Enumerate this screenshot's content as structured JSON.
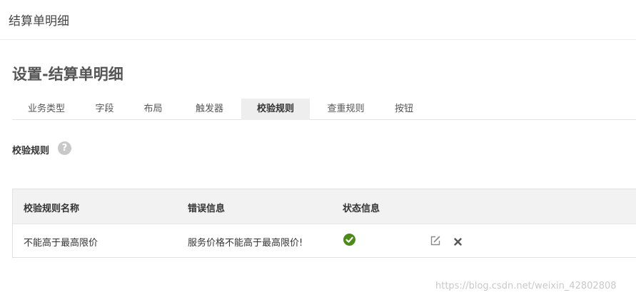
{
  "topbar": {
    "title": "结算单明细"
  },
  "page": {
    "title": "设置-结算单明细"
  },
  "tabs": [
    {
      "label": "业务类型"
    },
    {
      "label": "字段"
    },
    {
      "label": "布局"
    },
    {
      "label": "触发器"
    },
    {
      "label": "校验规则",
      "active": true
    },
    {
      "label": "查重规则"
    },
    {
      "label": "按钮"
    }
  ],
  "section": {
    "label": "校验规则",
    "help_icon": "question-icon",
    "help_glyph": "?"
  },
  "table": {
    "headers": [
      "校验规则名称",
      "错误信息",
      "状态信息"
    ],
    "rows": [
      {
        "name": "不能高于最高限价",
        "error": "服务价格不能高于最高限价!",
        "status_icon": "check-circle-icon",
        "actions": [
          "edit-icon",
          "delete-icon"
        ]
      }
    ]
  },
  "colors": {
    "status_ok": "#4c8a1a",
    "active_tab_bg": "#eeeeee",
    "header_bg": "#f2f2f2"
  },
  "watermark": "https://blog.csdn.net/weixin_42802808"
}
